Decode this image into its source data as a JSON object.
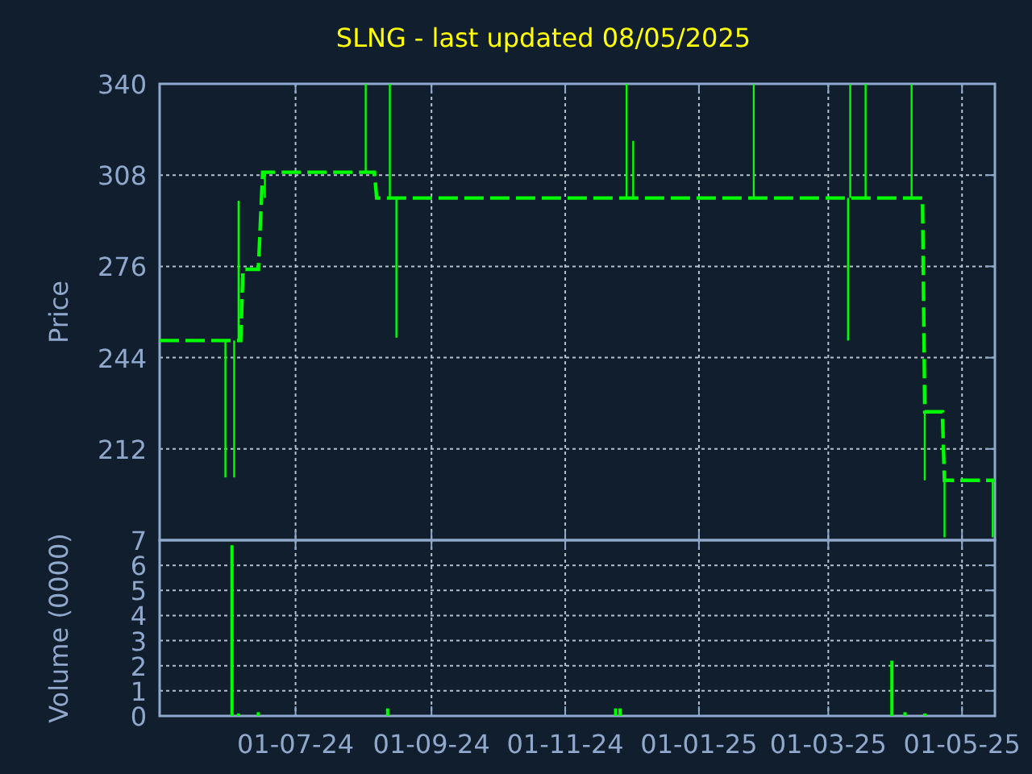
{
  "title": "SLNG - last updated 08/05/2025",
  "price_chart": {
    "chart_data": {
      "type": "line",
      "ylabel": "Price",
      "grid": true,
      "xlim": [
        "2024-04-30",
        "2025-05-16"
      ],
      "ylim": [
        180,
        340
      ],
      "yticks": [
        {
          "value": 212,
          "label": "212"
        },
        {
          "value": 244,
          "label": "244"
        },
        {
          "value": 276,
          "label": "276"
        },
        {
          "value": 308,
          "label": "308"
        },
        {
          "value": 340,
          "label": "340"
        }
      ],
      "x": [
        "2024-04-30",
        "2024-05-30",
        "2024-06-03",
        "2024-06-05",
        "2024-06-06",
        "2024-06-07",
        "2024-06-14",
        "2024-06-16",
        "2024-06-17",
        "2024-08-02",
        "2024-08-06",
        "2024-08-07",
        "2024-08-13",
        "2024-08-16",
        "2024-11-29",
        "2024-12-02",
        "2025-01-26",
        "2025-03-10",
        "2025-03-11",
        "2025-03-18",
        "2025-04-08",
        "2025-04-13",
        "2025-04-14",
        "2025-04-22",
        "2025-04-23",
        "2025-05-15",
        "2025-05-16"
      ],
      "series": [
        {
          "color": "#00ff00",
          "line_style": "dashed",
          "values": [
            250,
            250,
            250,
            250,
            250,
            275,
            275,
            309,
            309,
            309,
            309,
            300,
            300,
            300,
            300,
            300,
            300,
            300,
            300,
            300,
            300,
            300,
            225,
            225,
            201,
            201,
            201
          ],
          "errors": [
            null,
            [
              202,
              250
            ],
            [
              202,
              250
            ],
            [
              250,
              299
            ],
            null,
            null,
            null,
            null,
            [
              300,
              309
            ],
            [
              309,
              340
            ],
            null,
            null,
            [
              300,
              340
            ],
            [
              251,
              300
            ],
            [
              300,
              340
            ],
            [
              300,
              320
            ],
            [
              300,
              340
            ],
            [
              250,
              300
            ],
            [
              300,
              340
            ],
            [
              300,
              340
            ],
            [
              300,
              340
            ],
            null,
            [
              201,
              225
            ],
            null,
            [
              181,
              201
            ],
            [
              181,
              201
            ],
            null
          ]
        }
      ]
    }
  },
  "volume_chart": {
    "chart_data": {
      "type": "bar",
      "ylabel": "Volume (0000)",
      "grid": true,
      "xlim": [
        "2024-04-30",
        "2025-05-16"
      ],
      "ylim": [
        0,
        7
      ],
      "yticks": [
        {
          "value": 0,
          "label": "0"
        },
        {
          "value": 1,
          "label": "1"
        },
        {
          "value": 2,
          "label": "2"
        },
        {
          "value": 3,
          "label": "3"
        },
        {
          "value": 4,
          "label": "4"
        },
        {
          "value": 5,
          "label": "5"
        },
        {
          "value": 6,
          "label": "6"
        },
        {
          "value": 7,
          "label": "7"
        }
      ],
      "xticks": [
        {
          "value": "2024-07-01",
          "label": "01-07-24"
        },
        {
          "value": "2024-09-01",
          "label": "01-09-24"
        },
        {
          "value": "2024-11-01",
          "label": "01-11-24"
        },
        {
          "value": "2025-01-01",
          "label": "01-01-25"
        },
        {
          "value": "2025-03-01",
          "label": "01-03-25"
        },
        {
          "value": "2025-05-01",
          "label": "01-05-25"
        }
      ],
      "x": [
        "2024-06-02",
        "2024-06-05",
        "2024-06-14",
        "2024-08-12",
        "2024-11-24",
        "2024-11-26",
        "2025-03-30",
        "2025-04-05",
        "2025-04-14"
      ],
      "values": [
        6.8,
        0.1,
        0.15,
        0.3,
        0.3,
        0.3,
        2.2,
        0.15,
        0.1
      ]
    }
  }
}
